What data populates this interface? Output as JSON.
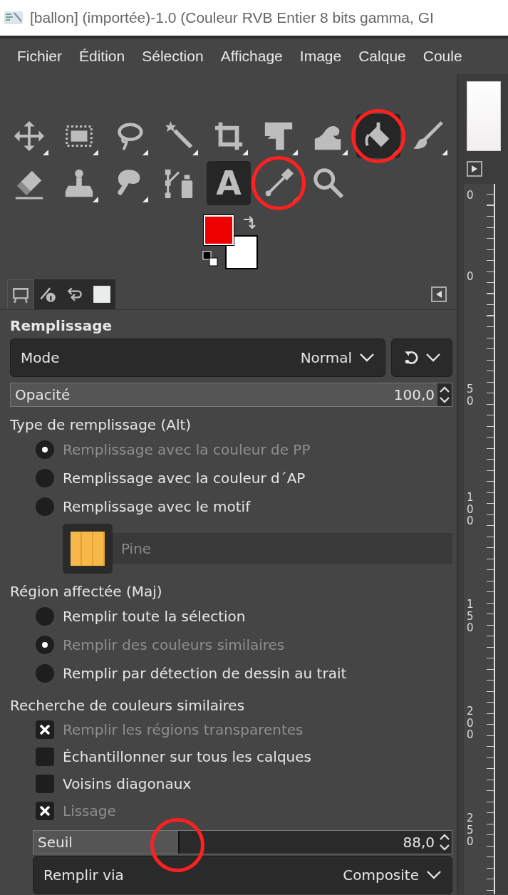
{
  "window": {
    "title": "[ballon] (importée)-1.0 (Couleur RVB Entier 8 bits gamma, GI"
  },
  "menu": [
    "Fichier",
    "Édition",
    "Sélection",
    "Affichage",
    "Image",
    "Calque",
    "Coule"
  ],
  "tools": [
    {
      "kind": "move",
      "selected": false,
      "group": true,
      "circled": false
    },
    {
      "kind": "rect-select",
      "selected": false,
      "group": true,
      "circled": false
    },
    {
      "kind": "lasso",
      "selected": false,
      "group": true,
      "circled": false
    },
    {
      "kind": "wand",
      "selected": false,
      "group": true,
      "circled": false
    },
    {
      "kind": "crop",
      "selected": false,
      "group": true,
      "circled": false
    },
    {
      "kind": "transform",
      "selected": false,
      "group": true,
      "circled": false
    },
    {
      "kind": "warp",
      "selected": false,
      "group": true,
      "circled": false
    },
    {
      "kind": "bucket",
      "selected": true,
      "group": true,
      "circled": true
    },
    {
      "kind": "brush",
      "selected": false,
      "group": true,
      "circled": false
    },
    {
      "kind": "eraser",
      "selected": false,
      "group": false,
      "circled": false
    },
    {
      "kind": "stamp",
      "selected": false,
      "group": true,
      "circled": false
    },
    {
      "kind": "smudge",
      "selected": false,
      "group": true,
      "circled": false
    },
    {
      "kind": "paths",
      "selected": false,
      "group": false,
      "circled": false
    },
    {
      "kind": "text",
      "glyph": "A",
      "selected": true,
      "group": false,
      "circled": false
    },
    {
      "kind": "picker",
      "selected": false,
      "group": true,
      "circled": true
    },
    {
      "kind": "zoom",
      "selected": false,
      "group": false,
      "circled": false
    }
  ],
  "colors": [
    {
      "kind": "foreground",
      "color": "#ee0000"
    },
    {
      "kind": "background",
      "color": "#ffffff"
    }
  ],
  "dock_tabs": [
    {
      "kind": "tool-options",
      "selected": true
    },
    {
      "kind": "pointer",
      "selected": false
    },
    {
      "kind": "undo",
      "selected": false
    },
    {
      "kind": "images",
      "selected": false
    }
  ],
  "options": {
    "title": "Remplissage",
    "mode": {
      "label": "Mode",
      "value": "Normal"
    },
    "opacity": {
      "label": "Opacité",
      "value": "100,0",
      "level": 1
    },
    "fill_type": {
      "label": "Type de remplissage (Alt)",
      "options": [
        {
          "label": "Remplissage avec la couleur de PP",
          "selected": true
        },
        {
          "label": "Remplissage avec la couleur d´AP",
          "selected": false
        },
        {
          "label": "Remplissage avec le motif",
          "selected": false
        }
      ]
    },
    "pattern": {
      "name": "Pine"
    },
    "region": {
      "label": "Région affectée (Maj)",
      "options": [
        {
          "label": "Remplir toute la sélection",
          "selected": false
        },
        {
          "label": "Remplir des couleurs similaires",
          "selected": true
        },
        {
          "label": "Remplir par détection de dessin au trait",
          "selected": false
        }
      ]
    },
    "similar": {
      "label": "Recherche de couleurs similaires",
      "options": [
        {
          "label": "Remplir les régions transparentes",
          "checked": true
        },
        {
          "label": "Échantillonner sur tous les calques",
          "checked": false
        },
        {
          "label": "Voisins diagonaux",
          "checked": false
        },
        {
          "label": "Lissage",
          "checked": true
        }
      ]
    },
    "threshold": {
      "label": "Seuil",
      "value": "88,0",
      "level": 0.345,
      "circled": true
    },
    "fill_via": {
      "label": "Remplir via",
      "value": "Composite"
    }
  },
  "ruler_labels": [
    "0",
    "0",
    "50",
    "100",
    "150",
    "200",
    "250"
  ]
}
